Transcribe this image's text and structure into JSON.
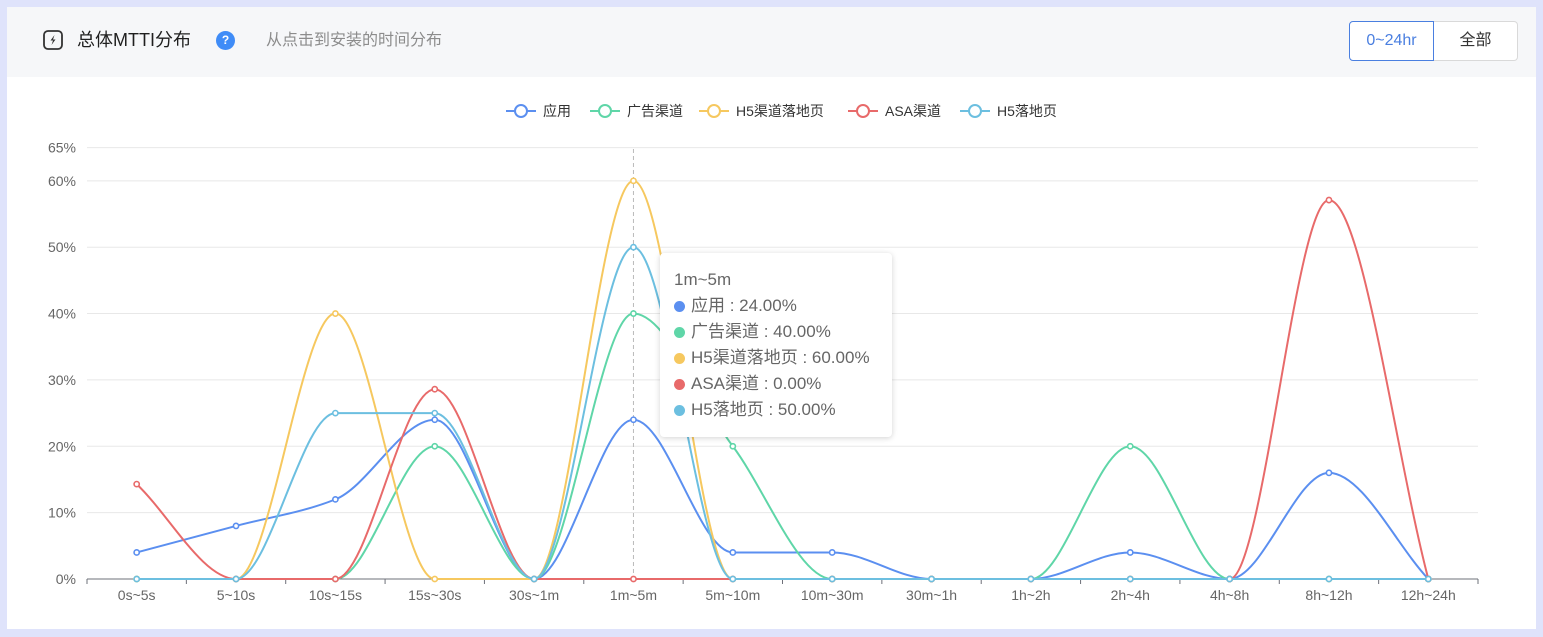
{
  "header": {
    "title": "总体MTTI分布",
    "help_label": "?",
    "subtitle": "从点击到安装的时间分布",
    "range_options": [
      "0~24hr",
      "全部"
    ],
    "selected_range": "0~24hr"
  },
  "chart_data": {
    "type": "line",
    "smooth": true,
    "categories": [
      "0s~5s",
      "5~10s",
      "10s~15s",
      "15s~30s",
      "30s~1m",
      "1m~5m",
      "5m~10m",
      "10m~30m",
      "30m~1h",
      "1h~2h",
      "2h~4h",
      "4h~8h",
      "8h~12h",
      "12h~24h"
    ],
    "y_ticks": [
      "0%",
      "10%",
      "20%",
      "30%",
      "40%",
      "50%",
      "60%",
      "65%"
    ],
    "ylim": [
      0,
      65
    ],
    "grid": true,
    "legend_position": "top-center",
    "series": [
      {
        "name": "应用",
        "color": "#5b8ff0",
        "values": [
          4,
          8,
          12,
          24,
          0,
          24,
          4,
          4,
          0,
          0,
          4,
          0,
          16,
          0
        ]
      },
      {
        "name": "广告渠道",
        "color": "#5fd6a8",
        "values": [
          0,
          0,
          0,
          20,
          0,
          40,
          20,
          0,
          0,
          0,
          20,
          0,
          0,
          0
        ]
      },
      {
        "name": "H5渠道落地页",
        "color": "#f6c85f",
        "values": [
          0,
          0,
          40,
          0,
          0,
          60,
          0,
          0,
          0,
          0,
          0,
          0,
          0,
          0
        ]
      },
      {
        "name": "ASA渠道",
        "color": "#e86a6a",
        "values": [
          14.3,
          0,
          0,
          28.6,
          0,
          0,
          0,
          0,
          0,
          0,
          0,
          0,
          57.1,
          0
        ]
      },
      {
        "name": "H5落地页",
        "color": "#6cbfe0",
        "values": [
          0,
          0,
          25,
          25,
          0,
          50,
          0,
          0,
          0,
          0,
          0,
          0,
          0,
          0
        ]
      }
    ],
    "tooltip": {
      "title": "1m~5m",
      "rows": [
        {
          "label": "应用 : 24.00%",
          "color": "#5b8ff0"
        },
        {
          "label": "广告渠道 : 40.00%",
          "color": "#5fd6a8"
        },
        {
          "label": "H5渠道落地页 : 60.00%",
          "color": "#f6c85f"
        },
        {
          "label": "ASA渠道 : 0.00%",
          "color": "#e86a6a"
        },
        {
          "label": "H5落地页 : 50.00%",
          "color": "#6cbfe0"
        }
      ]
    }
  }
}
